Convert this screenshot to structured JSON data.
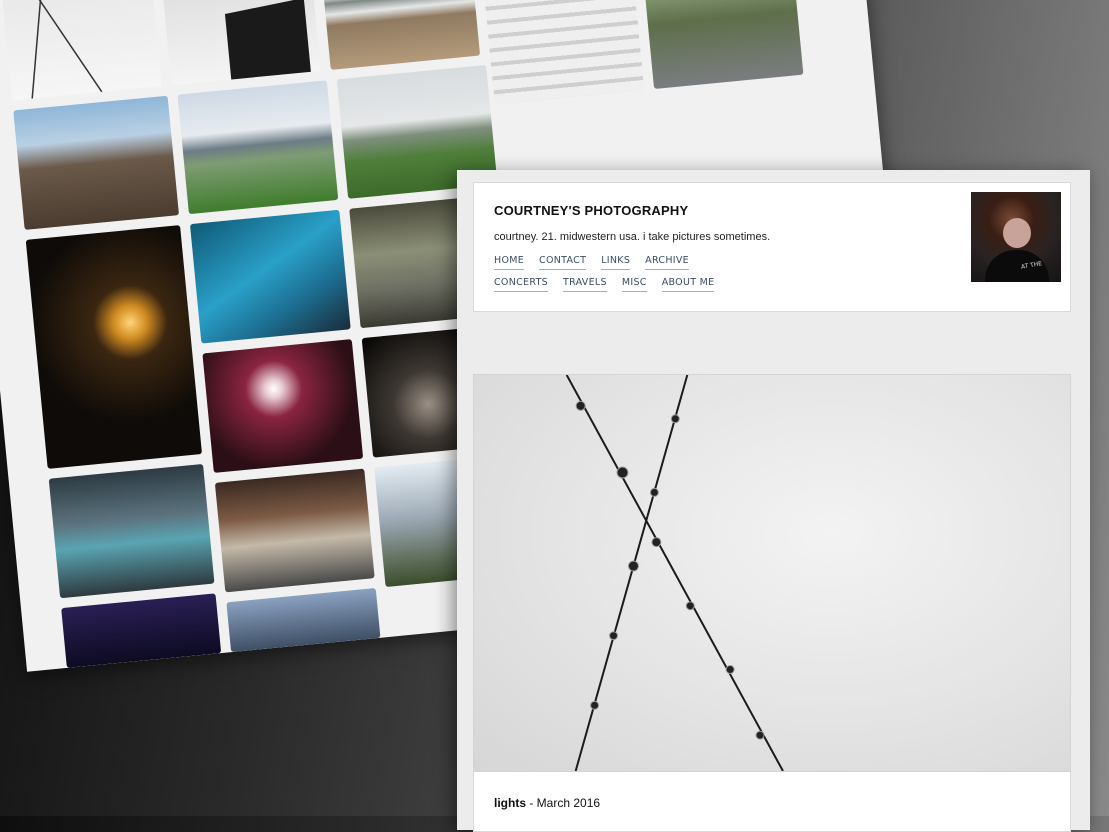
{
  "blog": {
    "title": "COURTNEY'S PHOTOGRAPHY",
    "description": "courtney. 21. midwestern usa. i take pictures sometimes.",
    "nav_row1": [
      "HOME",
      "CONTACT",
      "LINKS",
      "ARCHIVE"
    ],
    "nav_row2": [
      "CONCERTS",
      "TRAVELS",
      "MISC",
      "ABOUT ME"
    ],
    "avatar_shirt_text": "AT THE"
  },
  "post": {
    "photo_title": "lights",
    "separator": " - ",
    "date": "March 2016"
  },
  "colors": {
    "nav_link": "#3c4d63",
    "window_bg": "#ececec",
    "card_bg": "#ffffff"
  }
}
